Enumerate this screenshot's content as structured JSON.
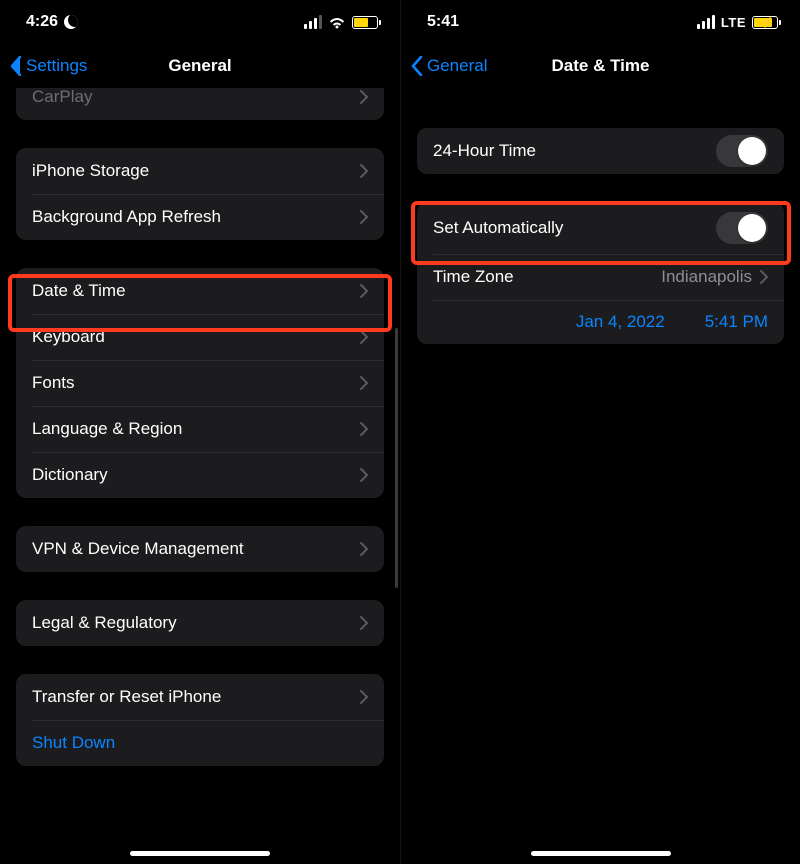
{
  "left": {
    "status": {
      "time": "4:26"
    },
    "nav": {
      "back": "Settings",
      "title": "General"
    },
    "groups": [
      {
        "rows": [
          {
            "label": "CarPlay"
          }
        ],
        "partial_top": true
      },
      {
        "rows": [
          {
            "label": "iPhone Storage"
          },
          {
            "label": "Background App Refresh"
          }
        ]
      },
      {
        "rows": [
          {
            "label": "Date & Time",
            "highlighted": true
          },
          {
            "label": "Keyboard"
          },
          {
            "label": "Fonts"
          },
          {
            "label": "Language & Region"
          },
          {
            "label": "Dictionary"
          }
        ]
      },
      {
        "rows": [
          {
            "label": "VPN & Device Management"
          }
        ]
      },
      {
        "rows": [
          {
            "label": "Legal & Regulatory"
          }
        ]
      },
      {
        "rows": [
          {
            "label": "Transfer or Reset iPhone"
          },
          {
            "label": "Shut Down",
            "link": true
          }
        ]
      }
    ]
  },
  "right": {
    "status": {
      "time": "5:41",
      "network": "LTE"
    },
    "nav": {
      "back": "General",
      "title": "Date & Time"
    },
    "rows": {
      "twenty_four": "24-Hour Time",
      "set_auto": "Set Automatically",
      "tz_label": "Time Zone",
      "tz_value": "Indianapolis",
      "date": "Jan 4, 2022",
      "time": "5:41 PM"
    }
  },
  "colors": {
    "accent": "#0a84ff",
    "highlight": "#ff3b1f"
  }
}
